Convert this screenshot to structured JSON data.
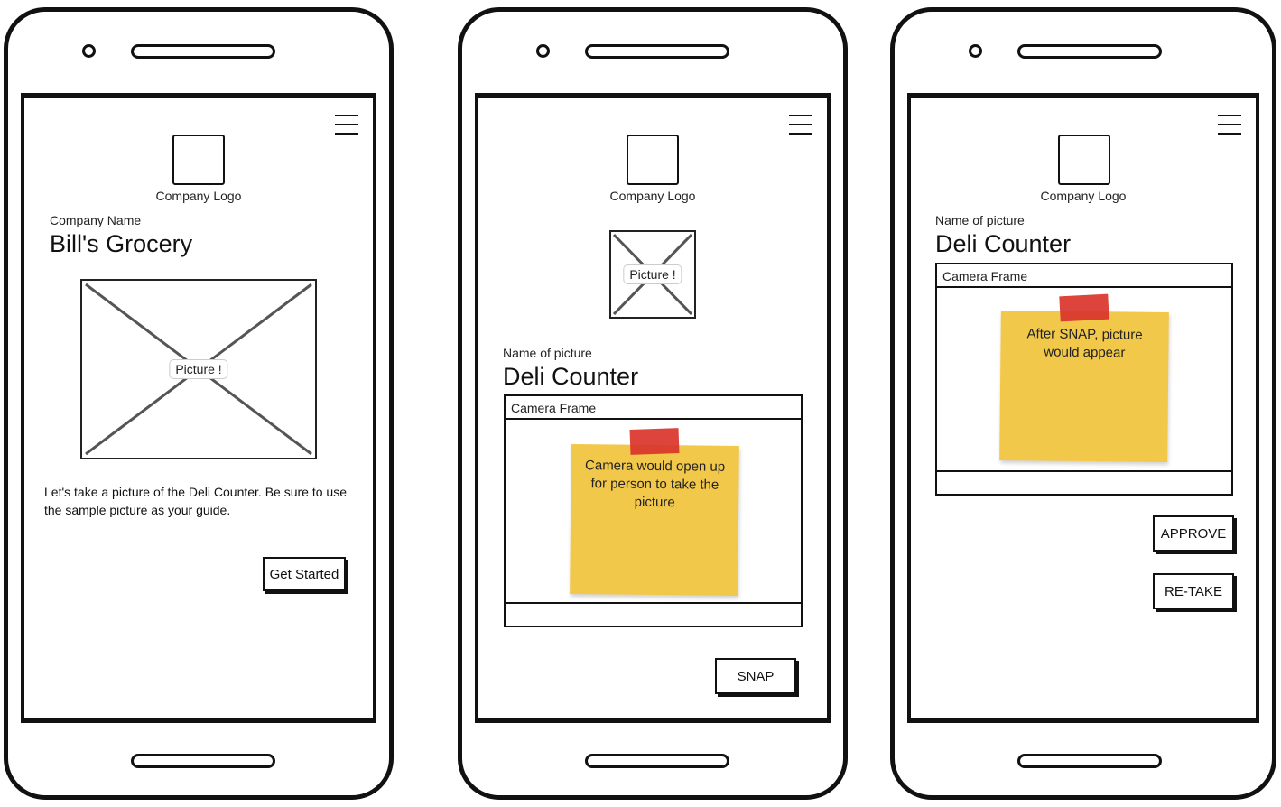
{
  "phone1": {
    "logo_label": "Company Logo",
    "company_name_label": "Company Name",
    "company_name": "Bill's Grocery",
    "picture_tag": "Picture !",
    "description": "Let's take a picture of the Deli Counter. Be sure to use the sample picture as your guide.",
    "button_label": "Get Started"
  },
  "phone2": {
    "logo_label": "Company Logo",
    "picture_tag": "Picture !",
    "name_label": "Name of picture",
    "name": "Deli Counter",
    "frame_header": "Camera Frame",
    "note_text": "Camera would open up for person to take the picture",
    "button_label": "SNAP"
  },
  "phone3": {
    "logo_label": "Company Logo",
    "name_label": "Name of picture",
    "name": "Deli Counter",
    "frame_header": "Camera Frame",
    "note_text": "After SNAP, picture would appear",
    "approve_label": "APPROVE",
    "retake_label": "RE-TAKE"
  },
  "colors": {
    "sticky_note": "#f2c84b",
    "tape": "#d9342b",
    "outline": "#111111"
  },
  "icons": {
    "menu": "hamburger-menu-icon",
    "placeholder": "image-placeholder-icon"
  }
}
